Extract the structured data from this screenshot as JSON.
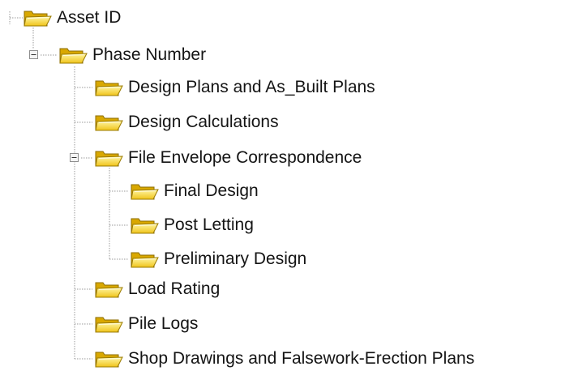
{
  "tree": {
    "root": {
      "label": "Asset ID",
      "icon": "folder-icon"
    },
    "phase": {
      "label": "Phase Number",
      "icon": "folder-icon",
      "expanded": true
    },
    "children": {
      "design_plans": {
        "label": "Design Plans and As_Built Plans",
        "icon": "folder-icon"
      },
      "design_calcs": {
        "label": "Design Calculations",
        "icon": "folder-icon"
      },
      "file_envelope": {
        "label": "File Envelope Correspondence",
        "icon": "folder-icon",
        "expanded": true
      },
      "final_design": {
        "label": "Final Design",
        "icon": "folder-icon"
      },
      "post_letting": {
        "label": "Post Letting",
        "icon": "folder-icon"
      },
      "preliminary": {
        "label": "Preliminary Design",
        "icon": "folder-icon"
      },
      "load_rating": {
        "label": "Load Rating",
        "icon": "folder-icon"
      },
      "pile_logs": {
        "label": "Pile Logs",
        "icon": "folder-icon"
      },
      "shop_drawings": {
        "label": "Shop Drawings and Falsework-Erection Plans",
        "icon": "folder-icon"
      }
    }
  },
  "colors": {
    "folder_light": "#fff48a",
    "folder_dark": "#e8b800",
    "folder_outline": "#9a7a00",
    "connector": "#9a9a9a",
    "text": "#141414"
  }
}
